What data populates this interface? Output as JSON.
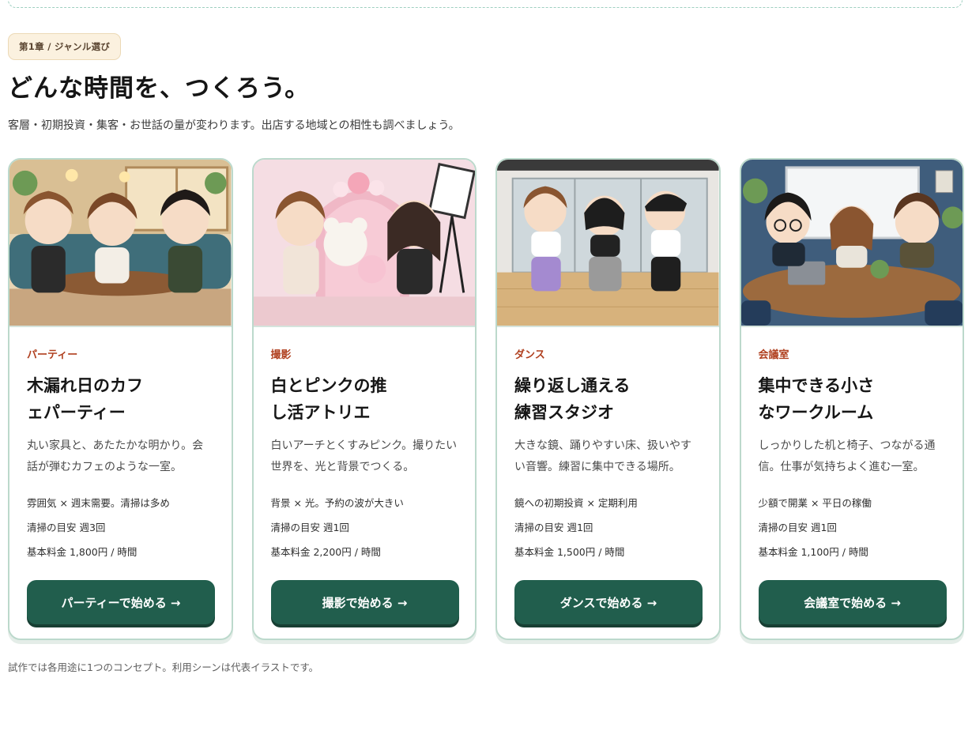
{
  "chapter_badge": "第1章 / ジャンル選び",
  "title": "どんな時間を、つくろう。",
  "subtitle": "客層・初期投資・集客・お世話の量が変わります。出店する地域との相性も調べましょう。",
  "cards": [
    {
      "genre": "パーティー",
      "title": "木漏れ日のカフェパーティー",
      "description": "丸い家具と、あたたかな明かり。会話が弾むカフェのような一室。",
      "trait": "雰囲気 × 週末需要。清掃は多め",
      "cleaning": "清掃の目安 週3回",
      "price": "基本料金 1,800円 / 時間",
      "button": "パーティーで始める →",
      "illustration": "cafe-party-illustration"
    },
    {
      "genre": "撮影",
      "title": "白とピンクの推し活アトリエ",
      "description": "白いアーチとくすみピンク。撮りたい世界を、光と背景でつくる。",
      "trait": "背景 × 光。予約の波が大きい",
      "cleaning": "清掃の目安 週1回",
      "price": "基本料金 2,200円 / 時間",
      "button": "撮影で始める →",
      "illustration": "photo-atelier-illustration"
    },
    {
      "genre": "ダンス",
      "title": "繰り返し通える練習スタジオ",
      "description": "大きな鏡、踊りやすい床、扱いやすい音響。練習に集中できる場所。",
      "trait": "鏡への初期投資 × 定期利用",
      "cleaning": "清掃の目安 週1回",
      "price": "基本料金 1,500円 / 時間",
      "button": "ダンスで始める →",
      "illustration": "dance-studio-illustration"
    },
    {
      "genre": "会議室",
      "title": "集中できる小さなワークルーム",
      "description": "しっかりした机と椅子、つながる通信。仕事が気持ちよく進む一室。",
      "trait": "少額で開業 × 平日の稼働",
      "cleaning": "清掃の目安 週1回",
      "price": "基本料金 1,100円 / 時間",
      "button": "会議室で始める →",
      "illustration": "meeting-room-illustration"
    }
  ],
  "footer_note": "試作では各用途に1つのコンセプト。利用シーンは代表イラストです。",
  "colors": {
    "accent_green": "#215e4d",
    "genre_red": "#b0401f",
    "badge_bg": "#fbf1df",
    "card_border": "#bcd9cc"
  }
}
